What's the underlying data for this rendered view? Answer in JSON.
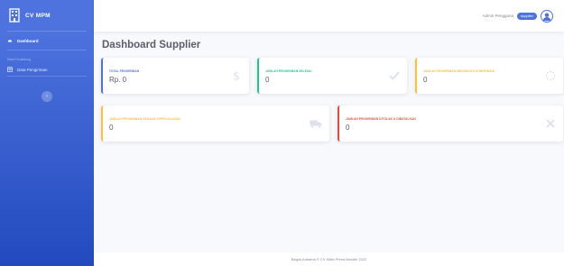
{
  "brand": {
    "name": "CV MPM"
  },
  "sidebar": {
    "dashboard_label": "Dashboard",
    "section_heading": "Data Pendukung",
    "data_pengiriman_label": "Data Pengiriman"
  },
  "topbar": {
    "user_name": "Admin Pengguna",
    "role_badge": "supplier"
  },
  "page": {
    "title": "Dashboard Supplier"
  },
  "cards": [
    {
      "label": "Total Pengiriman",
      "value": "Rp. 0",
      "color": "#4e73df",
      "icon": "dollar-icon"
    },
    {
      "label": "Jumlah Pengiriman Selesai",
      "value": "0",
      "color": "#1cc88a",
      "icon": "check-icon"
    },
    {
      "label": "Jumlah Pengiriman Menunggu Konfirmasi",
      "value": "0",
      "color": "#f6c23e",
      "icon": "spinner-icon"
    },
    {
      "label": "Jumlah Pengiriman Sedang Diperjalanan",
      "value": "0",
      "color": "#f6c23e",
      "icon": "truck-icon"
    },
    {
      "label": "Jumlah Pengiriman Ditolak & Dibatalkan",
      "value": "0",
      "color": "#e74a3b",
      "icon": "close-icon"
    }
  ],
  "footer": {
    "text": "Bagus Adhama © CV Mitra Prima Mandiri 2022"
  }
}
